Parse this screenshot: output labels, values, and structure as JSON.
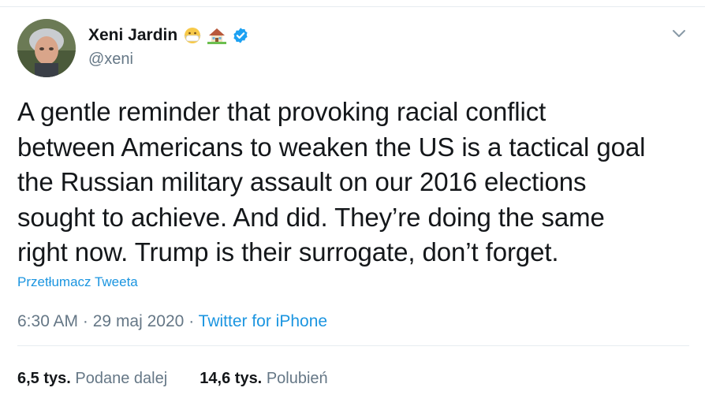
{
  "tweet": {
    "author": {
      "display_name": "Xeni Jardin",
      "handle": "@xeni",
      "emoji": [
        "face-with-medical-mask",
        "house-with-garden"
      ],
      "verified": true
    },
    "text_lines": [
      "A gentle reminder that provoking racial conflict",
      "between Americans to weaken the US is a tactical goal",
      "the Russian military assault on our 2016 elections",
      "sought to achieve. And did. They’re doing the same",
      "right now. Trump is their surrogate, don’t forget."
    ],
    "translate_link": "Przetłumacz Tweeta",
    "time": "6:30 AM",
    "separator": "·",
    "date": "29 maj 2020",
    "source": "Twitter for iPhone",
    "stats": {
      "retweets_count": "6,5 tys.",
      "retweets_label": "Podane dalej",
      "likes_count": "14,6 tys.",
      "likes_label": "Polubień"
    }
  },
  "colors": {
    "text": "#14171a",
    "secondary": "#657786",
    "link": "#1b95e0",
    "verified_badge": "#1da1f2",
    "divider": "#e6ecf0"
  },
  "icons": [
    "avatar",
    "mask-face-emoji",
    "house-emoji",
    "verified-badge-icon",
    "chevron-down-icon"
  ]
}
